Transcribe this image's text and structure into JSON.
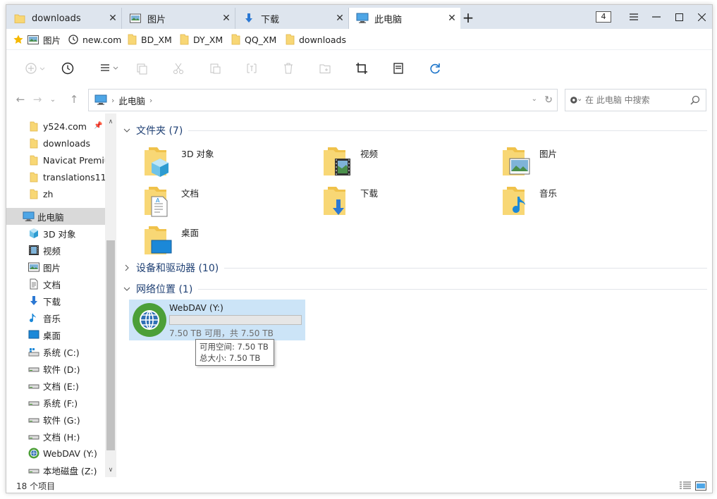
{
  "tabs": [
    {
      "label": "downloads",
      "icon": "folder-icon"
    },
    {
      "label": "图片",
      "icon": "pictures-icon"
    },
    {
      "label": "下载",
      "icon": "download-icon"
    },
    {
      "label": "此电脑",
      "icon": "computer-icon"
    }
  ],
  "tab_count": "4",
  "bookmarks": [
    {
      "label": "图片",
      "icon": "pictures-icon"
    },
    {
      "label": "new.com",
      "icon": "history-icon"
    },
    {
      "label": "BD_XM",
      "icon": "folder-icon"
    },
    {
      "label": "DY_XM",
      "icon": "folder-icon"
    },
    {
      "label": "QQ_XM",
      "icon": "folder-icon"
    },
    {
      "label": "downloads",
      "icon": "folder-icon"
    }
  ],
  "address": {
    "location": "此电脑"
  },
  "search": {
    "placeholder": "在 此电脑 中搜索"
  },
  "sidebar": {
    "quick_access": [
      {
        "label": "y524.com"
      },
      {
        "label": "downloads"
      },
      {
        "label": "Navicat Premiu"
      },
      {
        "label": "translations11"
      },
      {
        "label": "zh"
      }
    ],
    "this_pc": {
      "label": "此电脑"
    },
    "pc_items": [
      {
        "label": "3D 对象",
        "icon": "3d-objects-icon"
      },
      {
        "label": "视频",
        "icon": "videos-icon"
      },
      {
        "label": "图片",
        "icon": "pictures-icon"
      },
      {
        "label": "文档",
        "icon": "documents-icon"
      },
      {
        "label": "下载",
        "icon": "download-icon"
      },
      {
        "label": "音乐",
        "icon": "music-icon"
      },
      {
        "label": "桌面",
        "icon": "desktop-icon"
      },
      {
        "label": "系统 (C:)",
        "icon": "system-drive-icon"
      },
      {
        "label": "软件 (D:)",
        "icon": "drive-icon"
      },
      {
        "label": "文档 (E:)",
        "icon": "drive-icon"
      },
      {
        "label": "系统 (F:)",
        "icon": "drive-icon"
      },
      {
        "label": "软件 (G:)",
        "icon": "drive-icon"
      },
      {
        "label": "文档 (H:)",
        "icon": "drive-icon"
      },
      {
        "label": "WebDAV (Y:)",
        "icon": "network-drive-icon"
      },
      {
        "label": "本地磁盘 (Z:)",
        "icon": "drive-icon"
      }
    ]
  },
  "groups": {
    "folders": {
      "title": "文件夹 (7)"
    },
    "devices": {
      "title": "设备和驱动器 (10)"
    },
    "network": {
      "title": "网络位置 (1)"
    }
  },
  "folders": [
    {
      "label": "3D 对象"
    },
    {
      "label": "视频"
    },
    {
      "label": "图片"
    },
    {
      "label": "文档"
    },
    {
      "label": "下载"
    },
    {
      "label": "音乐"
    },
    {
      "label": "桌面"
    }
  ],
  "network_drive": {
    "name": "WebDAV (Y:)",
    "free_text": "7.50 TB 可用，共 7.50 TB",
    "used_fraction": 0
  },
  "tooltip": {
    "line1": "可用空间: 7.50 TB",
    "line2": "总大小: 7.50 TB"
  },
  "status": {
    "item_count": "18 个项目"
  },
  "colors": {
    "accent": "#0078d7",
    "folder": "#f8d775",
    "selection": "#cce4f7"
  }
}
